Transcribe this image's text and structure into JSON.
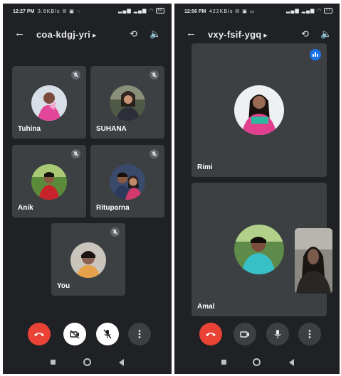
{
  "left": {
    "status": {
      "time": "12:27 PM",
      "speed": "3.6KB/s",
      "battery": "80"
    },
    "meeting_code": "coa-kdgj-yri",
    "participants": [
      {
        "name": "Tuhina",
        "muted": true
      },
      {
        "name": "SUHANA",
        "muted": true
      },
      {
        "name": "Anik",
        "muted": true
      },
      {
        "name": "Rituparna",
        "muted": true
      },
      {
        "name": "You",
        "muted": true
      }
    ],
    "controls": {
      "end_call": "end-call",
      "camera": "camera-off",
      "mic": "mic-off",
      "more": "more-options"
    }
  },
  "right": {
    "status": {
      "time": "12:56 PM",
      "speed": "422KB/s",
      "battery": "77"
    },
    "meeting_code": "vxy-fsif-ygq",
    "participants": [
      {
        "name": "Rimi",
        "speaking": true
      },
      {
        "name": "Amal",
        "speaking": false
      }
    ],
    "controls": {
      "end_call": "end-call",
      "camera": "camera-on",
      "mic": "mic-on",
      "more": "more-options"
    }
  },
  "colors": {
    "background": "#202124",
    "tile": "#3c4043",
    "end_call": "#ea4335",
    "speaking": "#1a73e8"
  }
}
